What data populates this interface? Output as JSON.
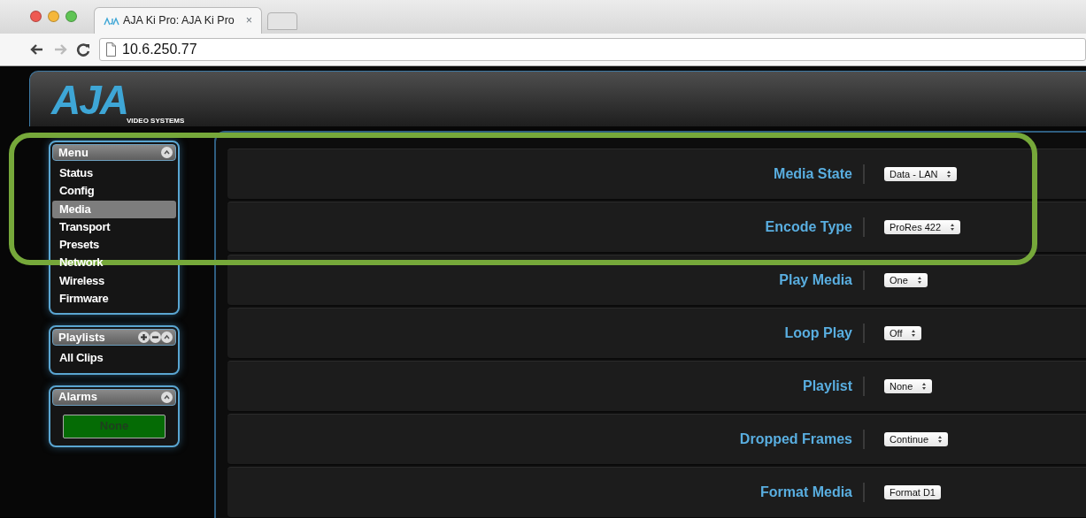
{
  "browser": {
    "tab_title": "AJA Ki Pro: AJA Ki Pro",
    "url": "10.6.250.77",
    "close": "×",
    "back_enabled": true,
    "forward_enabled": false
  },
  "header": {
    "logo": "AJA",
    "logo_subtitle": "VIDEO SYSTEMS"
  },
  "sidebar": [
    {
      "title": "Menu",
      "kind": "list",
      "items": [
        {
          "label": "Status",
          "selected": false
        },
        {
          "label": "Config",
          "selected": false
        },
        {
          "label": "Media",
          "selected": true
        },
        {
          "label": "Transport",
          "selected": false
        },
        {
          "label": "Presets",
          "selected": false
        },
        {
          "label": "Network",
          "selected": false
        },
        {
          "label": "Wireless",
          "selected": false
        },
        {
          "label": "Firmware",
          "selected": false
        }
      ]
    },
    {
      "title": "Playlists",
      "kind": "list",
      "add_remove": true,
      "items": [
        {
          "label": "All Clips",
          "selected": false
        }
      ]
    },
    {
      "title": "Alarms",
      "kind": "alarm",
      "status": "None"
    }
  ],
  "settings": [
    {
      "label": "Media State",
      "kind": "select",
      "value": "Data - LAN"
    },
    {
      "label": "Encode Type",
      "kind": "select",
      "value": "ProRes 422"
    },
    {
      "label": "Play Media",
      "kind": "select",
      "value": "One"
    },
    {
      "label": "Loop Play",
      "kind": "select",
      "value": "Off"
    },
    {
      "label": "Playlist",
      "kind": "select",
      "value": "None"
    },
    {
      "label": "Dropped Frames",
      "kind": "select",
      "value": "Continue"
    },
    {
      "label": "Format Media",
      "kind": "button",
      "value": "Format D1"
    }
  ],
  "annotation": {
    "kind": "outline"
  }
}
